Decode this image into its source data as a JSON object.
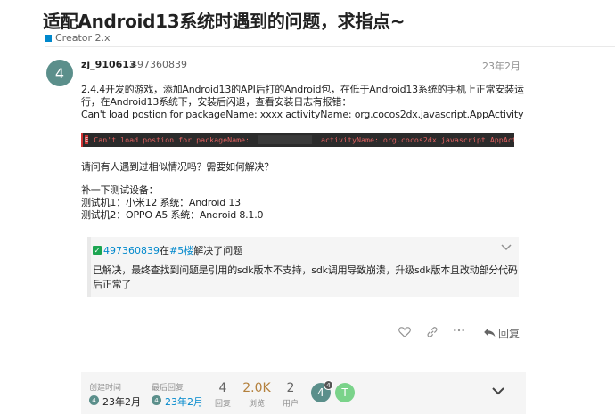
{
  "topic": {
    "title": "适配Android13系统时遇到的问题，求指点~",
    "category": "Creator 2.x",
    "category_color": "#0088cc"
  },
  "post": {
    "avatar_letter": "4",
    "avatar_color": "#5b8f8b",
    "username": "zj_910613",
    "userid": "497360839",
    "date": "23年2月",
    "lines": [
      "2.4.4开发的游戏，添加Android13的API后打的Android包，在低于Android13系统的手机上正常安装运",
      "行，在Android13系统下，安装后闪退，查看安装日志有报错：",
      "Can't load postion for packageName: xxxx activityName: org.cocos2dx.javascript.AppActivity"
    ],
    "code": {
      "badge": "E",
      "prefix": "Can't load postion for packageName:",
      "suffix": "activityName: org.cocos2dx.javascript.AppActivity"
    },
    "question": "请问有人遇到过相似情况吗？需要如何解决？",
    "devices_title": "补一下测试设备：",
    "device1": "测试机1：小米12 系统：Android 13",
    "device2": "测试机2：OPPO A5 系统：Android 8.1.0"
  },
  "solution": {
    "user": "497360839",
    "in": "在",
    "floor": "#5楼",
    "solved": "解决了问题",
    "text1": "已解决，最终查找到问题是引用的sdk版本不支持，sdk调用导致崩溃，升级sdk版本且改动部分代码",
    "text2": "后正常了",
    "accent": "#1ca551"
  },
  "actions": {
    "reply_label": "回复"
  },
  "stats": {
    "created_label": "创建时间",
    "created_date": "23年2月",
    "last_reply_label": "最后回复",
    "last_reply_date": "23年2月",
    "replies_count": "4",
    "replies_label": "回复",
    "views_count": "2.0K",
    "views_label": "浏览",
    "users_count": "2",
    "users_label": "用户",
    "participants": [
      {
        "letter": "4",
        "color": "#5b8f8b",
        "badge": "4"
      },
      {
        "letter": "T",
        "color": "#7ad38a"
      }
    ]
  }
}
